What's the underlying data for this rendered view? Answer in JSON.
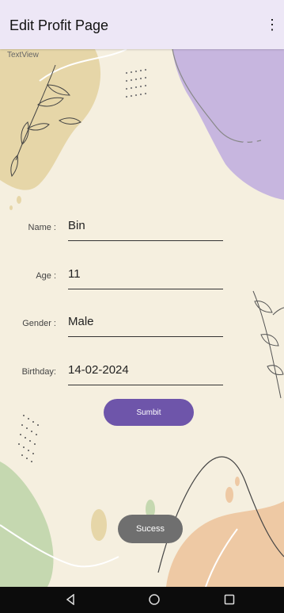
{
  "appbar": {
    "title": "Edit Profit Page",
    "menu_icon": "more-vert-icon"
  },
  "textview_label": "TextView",
  "form": {
    "name": {
      "label": "Name :",
      "value": "Bin"
    },
    "age": {
      "label": "Age :",
      "value": "11"
    },
    "gender": {
      "label": "Gender :",
      "value": "Male"
    },
    "birthday": {
      "label": "Birthday:",
      "value": "14-02-2024"
    }
  },
  "submit_button": "Sumbit",
  "toast": "Sucess",
  "nav_icons": [
    "back-icon",
    "home-icon",
    "recents-icon"
  ],
  "colors": {
    "appbar_bg": "#ede7f6",
    "button_bg": "#6e55aa",
    "toast_bg": "#6f6f6f",
    "background": "#f5efdf"
  }
}
